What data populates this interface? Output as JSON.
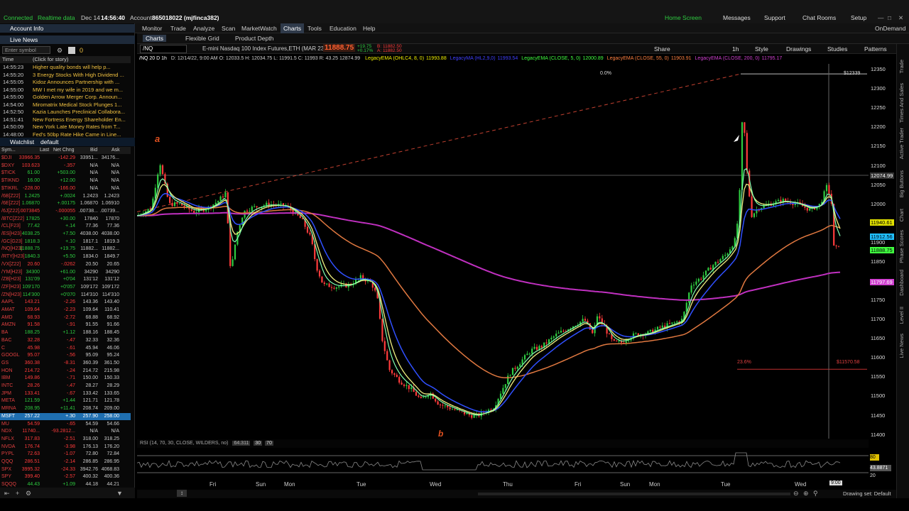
{
  "status": {
    "connection": "Connected",
    "realtime": "Realtime data",
    "date": "Dec 14",
    "time": "14:56:40",
    "account_label": "Account:",
    "account": "865018022 (mjfinca382)"
  },
  "top_right": [
    "Home Screen",
    "Messages",
    "Support",
    "Chat Rooms",
    "Setup"
  ],
  "nav_tabs": [
    "Monitor",
    "Trade",
    "Analyze",
    "Scan",
    "MarketWatch",
    "Charts",
    "Tools",
    "Education",
    "Help"
  ],
  "nav_active": "Charts",
  "on_demand": "OnDemand",
  "chart_subtabs": [
    "Charts",
    "Flexible Grid",
    "Product Depth"
  ],
  "sidebar": {
    "account_info": "Account Info",
    "live_news": "Live News",
    "enter_symbol_placeholder": "Enter symbol",
    "badge_count": "0",
    "news_header_time": "Time",
    "news_header_headline": "(Click for story)",
    "news": [
      {
        "time": "14:55:23",
        "headline": "Higher quality bonds will help p..."
      },
      {
        "time": "14:55:20",
        "headline": "3 Energy Stocks With High Dividend ..."
      },
      {
        "time": "14:55:05",
        "headline": "Kidoz Announces Partnership with ..."
      },
      {
        "time": "14:55:00",
        "headline": "MW I met my wife in 2019 and we m..."
      },
      {
        "time": "14:55:00",
        "headline": "Golden Arrow Merger Corp. Announ..."
      },
      {
        "time": "14:54:00",
        "headline": "Miromatrix Medical Stock Plunges 1..."
      },
      {
        "time": "14:52:50",
        "headline": "Kazia Launches Preclinical Collabora..."
      },
      {
        "time": "14:51:41",
        "headline": "New Fortress Energy Shareholder En..."
      },
      {
        "time": "14:50:09",
        "headline": "New York Late Money Rates from T..."
      },
      {
        "time": "14:48:00",
        "headline": "Fed's 50bp Rate Hike Came in Line..."
      }
    ],
    "watchlist_title": "Watchlist",
    "watchlist_name": "default",
    "wl_headers": [
      "Sym...",
      "Last",
      "Net Chng",
      "Bid",
      "Ask"
    ],
    "watchlist": [
      {
        "sym": "$DJI",
        "last": "33966.35",
        "chg": "-142.29",
        "bid": "33951...",
        "ask": "34176..."
      },
      {
        "sym": "$DXY",
        "last": "103.623",
        "chg": "-.357",
        "bid": "N/A",
        "ask": "N/A"
      },
      {
        "sym": "$TICK",
        "last": "61.00",
        "chg": "+503.00",
        "bid": "N/A",
        "ask": "N/A"
      },
      {
        "sym": "$TIKND",
        "last": "16.00",
        "chg": "+12.00",
        "bid": "N/A",
        "ask": "N/A"
      },
      {
        "sym": "$TIKRL",
        "last": "-228.00",
        "chg": "-166.00",
        "bid": "N/A",
        "ask": "N/A"
      },
      {
        "sym": "/6B[Z22]",
        "last": "1.2425",
        "chg": "+.0024",
        "bid": "1.2423",
        "ask": "1.2423"
      },
      {
        "sym": "/6E[Z22]",
        "last": "1.06870",
        "chg": "+.00175",
        "bid": "1.06870",
        "ask": "1.06910"
      },
      {
        "sym": "/6J[Z22]",
        "last": ".0073845",
        "chg": "-.000055",
        "bid": ".00738...",
        "ask": ".00739..."
      },
      {
        "sym": "/BTC[Z22]",
        "last": "17825",
        "chg": "+30.00",
        "bid": "17840",
        "ask": "17870"
      },
      {
        "sym": "/CL[F23]",
        "last": "77.42",
        "chg": "+.14",
        "bid": "77.36",
        "ask": "77.36"
      },
      {
        "sym": "/ES[H23]",
        "last": "4038.25",
        "chg": "+7.50",
        "bid": "4038.00",
        "ask": "4038.00"
      },
      {
        "sym": "/GC[G23]",
        "last": "1818.3",
        "chg": "+.10",
        "bid": "1817.1",
        "ask": "1819.3"
      },
      {
        "sym": "/NQ[H23]",
        "last": "11888.75",
        "chg": "+19.75",
        "bid": "11882...",
        "ask": "11882..."
      },
      {
        "sym": "/RTY[H23]",
        "last": "1840.3",
        "chg": "+5.50",
        "bid": "1834.0",
        "ask": "1849.7"
      },
      {
        "sym": "/VX[Z22]",
        "last": "20.60",
        "chg": "-.0262",
        "bid": "20.50",
        "ask": "20.65"
      },
      {
        "sym": "/YM[H23]",
        "last": "34300",
        "chg": "+61.00",
        "bid": "34290",
        "ask": "34290"
      },
      {
        "sym": "/ZB[H23]",
        "last": "131'09",
        "chg": "+0'04",
        "bid": "131'12",
        "ask": "131'12"
      },
      {
        "sym": "/ZF[H23]",
        "last": "109'170",
        "chg": "+0'057",
        "bid": "109'172",
        "ask": "109'172"
      },
      {
        "sym": "/ZN[H23]",
        "last": "114'300",
        "chg": "+0'070",
        "bid": "114'310",
        "ask": "114'310"
      },
      {
        "sym": "AAPL",
        "last": "143.21",
        "chg": "-2.26",
        "bid": "143.36",
        "ask": "143.40"
      },
      {
        "sym": "AMAT",
        "last": "109.64",
        "chg": "-2.23",
        "bid": "109.64",
        "ask": "110.41"
      },
      {
        "sym": "AMD",
        "last": "68.93",
        "chg": "-2.72",
        "bid": "68.88",
        "ask": "68.92"
      },
      {
        "sym": "AMZN",
        "last": "91.58",
        "chg": "-.91",
        "bid": "91.55",
        "ask": "91.66"
      },
      {
        "sym": "BA",
        "last": "188.25",
        "chg": "+1.12",
        "bid": "188.16",
        "ask": "188.45"
      },
      {
        "sym": "BAC",
        "last": "32.28",
        "chg": "-.47",
        "bid": "32.33",
        "ask": "32.36"
      },
      {
        "sym": "C",
        "last": "45.98",
        "chg": "-.61",
        "bid": "45.94",
        "ask": "46.06"
      },
      {
        "sym": "GOOGL",
        "last": "95.07",
        "chg": "-.56",
        "bid": "95.09",
        "ask": "95.24"
      },
      {
        "sym": "GS",
        "last": "360.38",
        "chg": "-8.31",
        "bid": "360.39",
        "ask": "361.50"
      },
      {
        "sym": "HON",
        "last": "214.72",
        "chg": "-.24",
        "bid": "214.72",
        "ask": "215.98"
      },
      {
        "sym": "IBM",
        "last": "149.86",
        "chg": "-.71",
        "bid": "150.00",
        "ask": "150.33"
      },
      {
        "sym": "INTC",
        "last": "28.26",
        "chg": "-.47",
        "bid": "28.27",
        "ask": "28.29"
      },
      {
        "sym": "JPM",
        "last": "133.41",
        "chg": "-.67",
        "bid": "133.42",
        "ask": "133.65"
      },
      {
        "sym": "META",
        "last": "121.59",
        "chg": "+1.44",
        "bid": "121.71",
        "ask": "121.78"
      },
      {
        "sym": "MRNA",
        "last": "208.95",
        "chg": "+11.41",
        "bid": "208.74",
        "ask": "209.00"
      },
      {
        "sym": "MSFT",
        "last": "257.22",
        "chg": "+.30",
        "bid": "257.90",
        "ask": "258.00",
        "selected": true
      },
      {
        "sym": "MU",
        "last": "54.59",
        "chg": "-.65",
        "bid": "54.59",
        "ask": "54.66"
      },
      {
        "sym": "NDX",
        "last": "11740...",
        "chg": "-93.2812...",
        "bid": "N/A",
        "ask": "N/A"
      },
      {
        "sym": "NFLX",
        "last": "317.83",
        "chg": "-2.51",
        "bid": "318.00",
        "ask": "318.25"
      },
      {
        "sym": "NVDA",
        "last": "176.74",
        "chg": "-3.98",
        "bid": "176.13",
        "ask": "176.20"
      },
      {
        "sym": "PYPL",
        "last": "72.63",
        "chg": "-1.07",
        "bid": "72.80",
        "ask": "72.84"
      },
      {
        "sym": "QQQ",
        "last": "286.51",
        "chg": "-2.14",
        "bid": "286.85",
        "ask": "286.95"
      },
      {
        "sym": "SPX",
        "last": "3995.32",
        "chg": "-24.33",
        "bid": "3942.76",
        "ask": "4068.83"
      },
      {
        "sym": "SPY",
        "last": "399.40",
        "chg": "-2.57",
        "bid": "400.32",
        "ask": "400.36"
      },
      {
        "sym": "SQQQ",
        "last": "44.43",
        "chg": "+1.09",
        "bid": "44.18",
        "ask": "44.21"
      }
    ]
  },
  "chart": {
    "symbol": "/NQ",
    "description": "E-mini Nasdaq 100 Index Futures,ETH (MAR 23)",
    "last_price": "11888.75",
    "change": "+19.75",
    "change_pct": "+0.17%",
    "bid_label": "B: 11882.50",
    "ask_label": "A: 11882.50",
    "toolbar": [
      "Share",
      "Style",
      "Drawings",
      "Studies",
      "Patterns"
    ],
    "timeframe": "1h",
    "header_line": "/NQ 20 D 1h",
    "ohlc": "D: 12/14/22, 9:00 AM  O: 12033.5  H: 12034.75  L: 11991.5  C: 11993  R: 43.25  12874.99",
    "studies": [
      {
        "label": "LegacyEMA (OHLC4, 8, 0)",
        "value": "11993.88",
        "color": "#f0f000"
      },
      {
        "label": "LegacyMA (HL2,9,0)",
        "value": "11993.54",
        "color": "#4040ff"
      },
      {
        "label": "LegacyEMA (CLOSE, 5, 0)",
        "value": "12000.89",
        "color": "#40ff40"
      },
      {
        "label": "LegacyEMA (CLOSE, 55, 0)",
        "value": "11903.91",
        "color": "#ff8040"
      },
      {
        "label": "LegacyEMA (CLOSE, 200, 0)",
        "value": "11795.17",
        "color": "#d040d0"
      }
    ],
    "price_ticks": [
      "12350",
      "12300",
      "12250",
      "12200",
      "12150",
      "12100",
      "12050",
      "12000",
      "11950",
      "11900",
      "11850",
      "11800",
      "11750",
      "11700",
      "11650",
      "11600",
      "11550",
      "11500",
      "11450",
      "11400"
    ],
    "price_labels": [
      {
        "text": "12339",
        "color": "#000000",
        "bg": "#000000",
        "fg": "#ffffff"
      },
      {
        "text": "12074.99",
        "bg": "#333333",
        "fg": "#ffffff"
      },
      {
        "text": "11940.61",
        "bg": "#e0e000",
        "fg": "#000000"
      },
      {
        "text": "11912.56",
        "bg": "#20c0ff",
        "fg": "#000000"
      },
      {
        "text": "11888.75",
        "bg": "#40ff40",
        "fg": "#000000"
      },
      {
        "text": "11797.69",
        "bg": "#d040d0",
        "fg": "#ffffff"
      }
    ],
    "fib_top": "0.0%",
    "fib_top_price": "$12339",
    "fib_bottom": "23.6%",
    "fib_bottom_price": "$11570.58",
    "wave_a": "a",
    "wave_b": "b",
    "time_ticks": [
      "Fri",
      "Sun",
      "Mon",
      "Tue",
      "Wed",
      "Thu",
      "Fri",
      "Sun",
      "Mon",
      "Tue",
      "Wed"
    ],
    "cursor_time": "9:00",
    "rsi": {
      "label": "RSI (14, 70, 30, CLOSE, WILDERS, no)",
      "value": "64.311",
      "ob_label": "30",
      "os_label": "70",
      "right_labels": [
        "80",
        "43.8871",
        "20"
      ]
    },
    "drawing_set": "Drawing set: Default"
  },
  "right_rail": [
    "Trade",
    "Times And Sales",
    "Active Trader",
    "Big Buttons",
    "Chart",
    "Phase Scores",
    "Dashboard",
    "Level II",
    "Live News"
  ]
}
